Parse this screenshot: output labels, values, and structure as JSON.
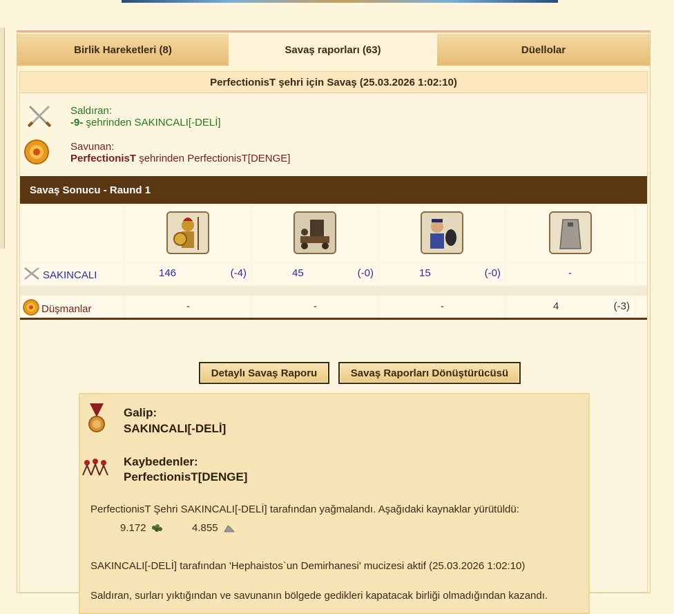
{
  "tabs": [
    {
      "label": "Birlik Hareketleri (8)"
    },
    {
      "label": "Savaş raporları (63)"
    },
    {
      "label": "Düellolar"
    }
  ],
  "battle": {
    "title": "PerfectionisT şehri için Savaş (25.03.2026 1:02:10)",
    "attacker_label": "Saldıran:",
    "attacker_city": "-9-",
    "attacker_rest": " şehrinden SAKINCALI[-DELİ]",
    "defender_label": "Savunan:",
    "defender_city": "PerfectionisT",
    "defender_rest": " şehrinden PerfectionisT[DENGE]"
  },
  "round": {
    "title": "Savaş Sonucu - Raund 1"
  },
  "units": [
    "hoplite",
    "catapult",
    "slinger",
    "wall"
  ],
  "rows": {
    "attacker": {
      "name": "SAKINCALI",
      "cells": [
        {
          "count": "146",
          "loss": "(-4)"
        },
        {
          "count": "45",
          "loss": "(-0)"
        },
        {
          "count": "15",
          "loss": "(-0)"
        },
        {
          "count": "-",
          "loss": ""
        }
      ]
    },
    "enemy": {
      "name": "Düşmanlar",
      "cells": [
        {
          "count": "-",
          "loss": ""
        },
        {
          "count": "-",
          "loss": ""
        },
        {
          "count": "-",
          "loss": ""
        },
        {
          "count": "4",
          "loss": "(-3)"
        }
      ]
    }
  },
  "buttons": {
    "detail": "Detaylı Savaş Raporu",
    "converter": "Savaş Raporları Dönüştürücüsü"
  },
  "result": {
    "winner_label": "Galip:",
    "winner_name": "SAKINCALI[-DELİ]",
    "loser_label": "Kaybedenler:",
    "loser_name": "PerfectionisT[DENGE]",
    "plunder_text": "PerfectionisT Şehri SAKINCALI[-DELİ] tarafından yağmalandı. Aşağıdaki kaynaklar yürütüldü:",
    "resource_wine": "9.172",
    "resource_marble": "4.855",
    "miracle_text": "SAKINCALI[-DELİ] tarafından 'Hephaistos`un Demirhanesi' mucizesi aktif (25.03.2026 1:02:10)",
    "walls_text": "Saldıran, surları yıktığından ve savunanın bölgede gedikleri kapatacak birliği olmadığından kazandı."
  },
  "icons": {
    "attacker": "crossed-swords-icon",
    "defender": "shield-icon",
    "winner": "medal-icon",
    "loser": "fallen-troops-icon",
    "wine": "grapes-icon",
    "marble": "marble-icon"
  },
  "colors": {
    "attacker_text": "#217a1f",
    "defender_text": "#7a1c1c",
    "round_bar": "#5a3712",
    "numbers": "#2a2ab0"
  }
}
